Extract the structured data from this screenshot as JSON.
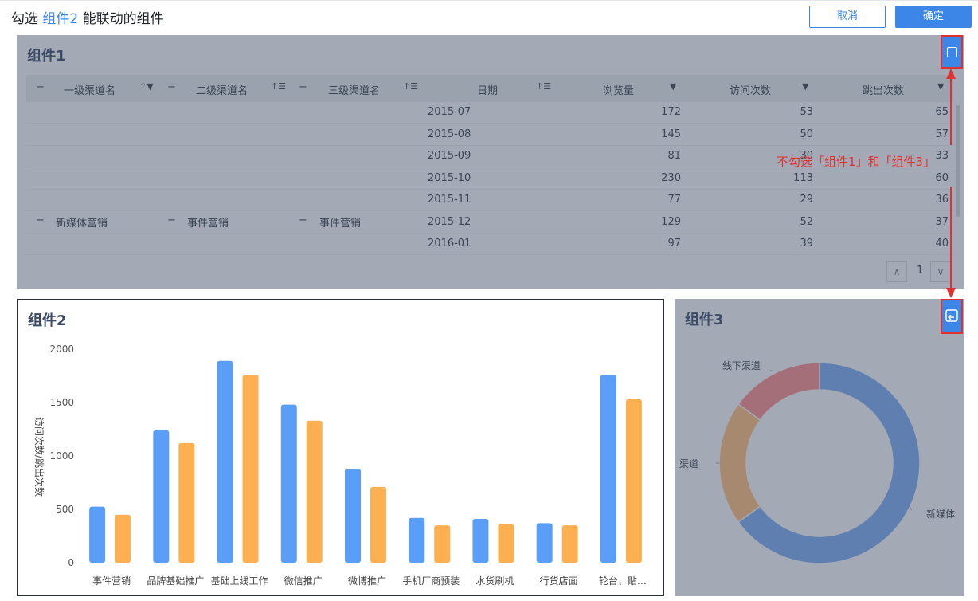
{
  "header": {
    "title_prefix": "勾选 ",
    "title_highlight": "组件2",
    "title_suffix": " 能联动的组件",
    "cancel_label": "取消",
    "ok_label": "确定"
  },
  "colors": {
    "accent": "#3c86e8",
    "annotation": "#e03131",
    "bar_blue": "#5b9ef7",
    "bar_orange": "#fdb052"
  },
  "panel1": {
    "title": "组件1",
    "columns": [
      "一级渠道名",
      "二级渠道名",
      "三级渠道名",
      "日期",
      "浏览量",
      "访问次数",
      "跳出次数"
    ],
    "dates": [
      "2015-07",
      "2015-08",
      "2015-09",
      "2015-10",
      "2015-11",
      "2015-12",
      "2016-01"
    ],
    "views": [
      "172",
      "145",
      "81",
      "230",
      "77",
      "129",
      "97"
    ],
    "visits": [
      "53",
      "50",
      "30",
      "113",
      "29",
      "52",
      "39"
    ],
    "bounces": [
      "65",
      "57",
      "33",
      "60",
      "36",
      "37",
      "40"
    ],
    "merged": {
      "level1": "新媒体营销",
      "level2": "事件营销",
      "level3": "事件营销"
    },
    "collapse_symbol": "−",
    "page": "1",
    "checkbox_icon": "checkbox-unchecked-icon"
  },
  "annotation": {
    "text": "不勾选「组件1」和「组件3」"
  },
  "panel2": {
    "title": "组件2",
    "ylabel": "访问次数/跳出次数"
  },
  "panel3": {
    "title": "组件3",
    "checkbox_icon": "linked-component-icon"
  },
  "chart_data": [
    {
      "type": "bar",
      "title": "组件2",
      "ylabel": "访问次数/跳出次数",
      "categories": [
        "事件营销",
        "品牌基础推广",
        "基础上线工作",
        "微信推广",
        "微博推广",
        "手机厂商预装",
        "水货刷机",
        "行货店面",
        "轮台、贴…"
      ],
      "series": [
        {
          "values": [
            525,
            1240,
            1890,
            1480,
            880,
            420,
            410,
            370,
            1760
          ]
        },
        {
          "values": [
            450,
            1120,
            1760,
            1330,
            710,
            350,
            360,
            350,
            1530
          ]
        }
      ],
      "yticks": [
        "0",
        "500",
        "1000",
        "1500",
        "2000"
      ],
      "ylim": [
        0,
        2000
      ]
    },
    {
      "type": "pie",
      "title": "组件3",
      "labels": [
        "新媒体",
        "渠道",
        "线下渠道"
      ],
      "values": [
        65,
        20,
        15
      ],
      "colors": [
        "#5f7fb0",
        "#a6896f",
        "#a56f79"
      ]
    }
  ]
}
